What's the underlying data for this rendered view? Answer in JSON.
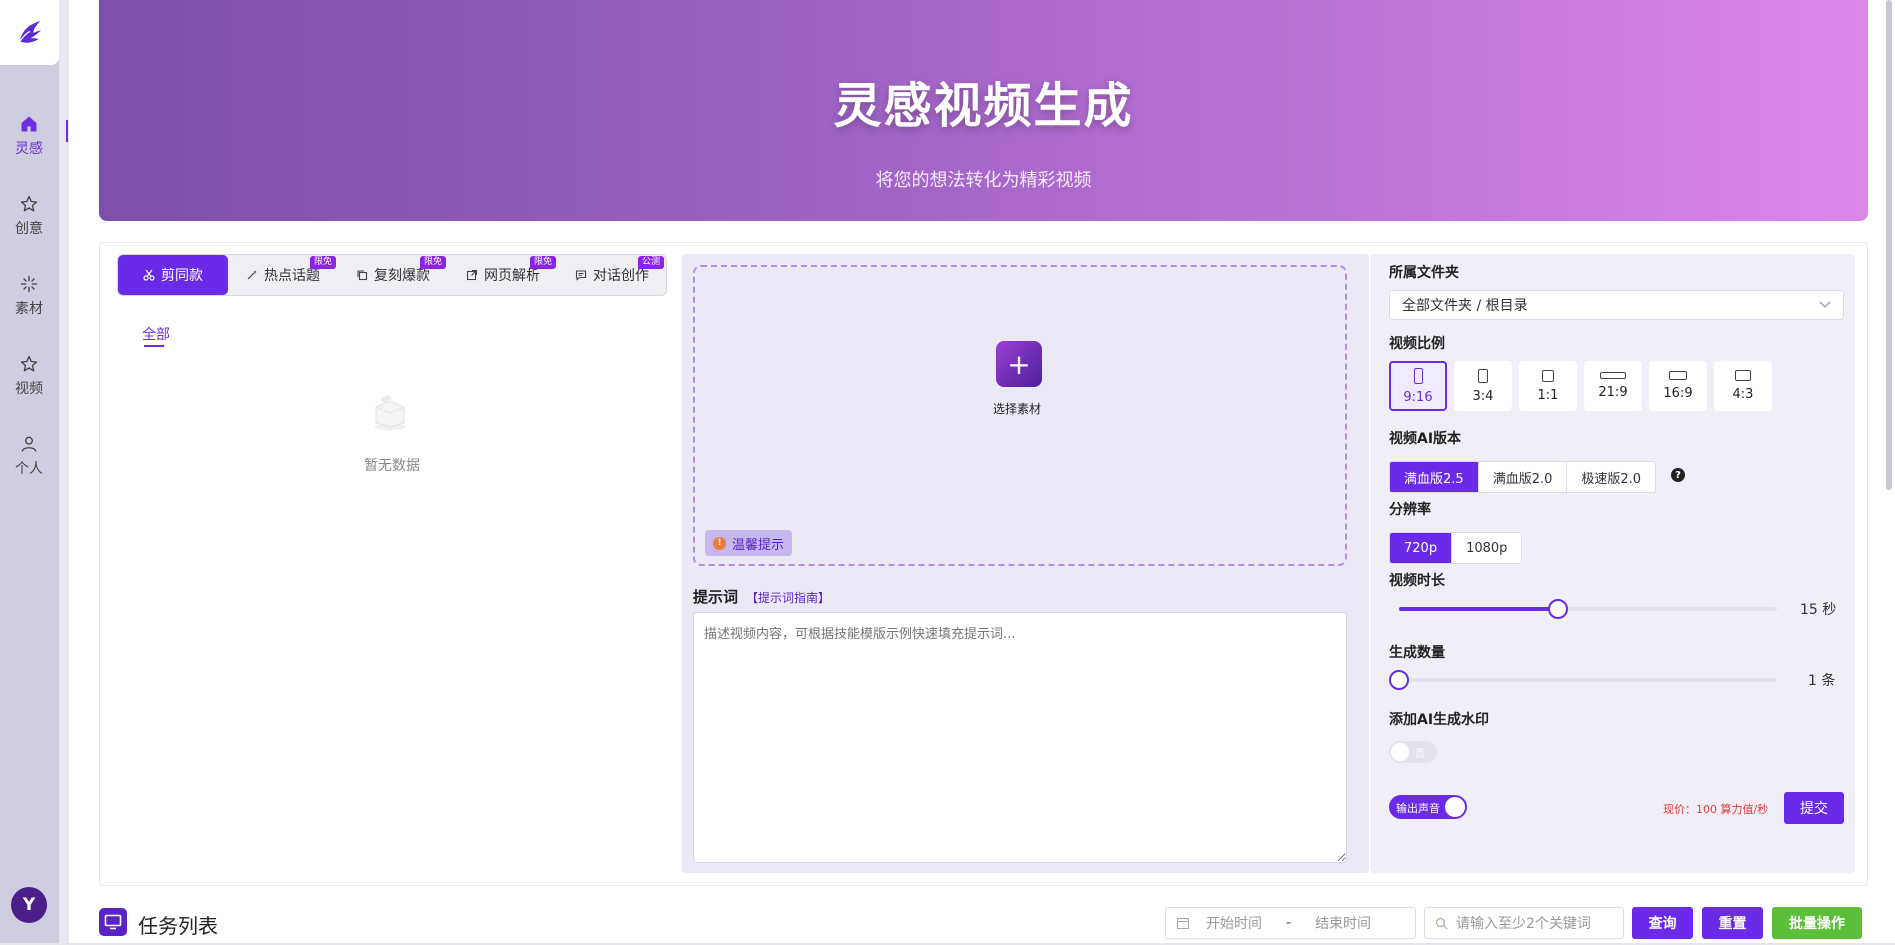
{
  "sidebar": {
    "items": [
      {
        "label": "灵感",
        "icon": "home-icon",
        "active": true
      },
      {
        "label": "创意",
        "icon": "star-icon"
      },
      {
        "label": "素材",
        "icon": "sparkle-icon"
      },
      {
        "label": "视频",
        "icon": "star-icon"
      },
      {
        "label": "个人",
        "icon": "user-icon"
      }
    ],
    "avatar": "Y"
  },
  "banner": {
    "title": "灵感视频生成",
    "subtitle": "将您的想法转化为精彩视频"
  },
  "tabs": [
    {
      "label": "剪同款",
      "icon": "scissors-icon",
      "active": true,
      "badge": ""
    },
    {
      "label": "热点话题",
      "icon": "wand-icon",
      "badge": "限免"
    },
    {
      "label": "复刻爆款",
      "icon": "copy-icon",
      "badge": "限免"
    },
    {
      "label": "网页解析",
      "icon": "external-link-icon",
      "badge": "限免"
    },
    {
      "label": "对话创作",
      "icon": "chat-icon",
      "badge": "公测"
    }
  ],
  "left": {
    "subtab": "全部",
    "empty_text": "暂无数据"
  },
  "upload": {
    "button_label": "选择素材",
    "tip_label": "温馨提示"
  },
  "prompt": {
    "label": "提示词",
    "guide": "【提示词指南】",
    "placeholder": "描述视频内容，可根据技能模版示例快速填充提示词..."
  },
  "settings": {
    "folder_label": "所属文件夹",
    "folder_value": "全部文件夹 / 根目录",
    "ratio_label": "视频比例",
    "ratios": [
      "9:16",
      "3:4",
      "1:1",
      "21:9",
      "16:9",
      "4:3"
    ],
    "ratio_selected": "9:16",
    "version_label": "视频AI版本",
    "versions": [
      "满血版2.5",
      "满血版2.0",
      "极速版2.0"
    ],
    "version_selected": "满血版2.5",
    "resolution_label": "分辨率",
    "resolutions": [
      "720p",
      "1080p"
    ],
    "resolution_selected": "720p",
    "duration_label": "视频时长",
    "duration_value": "15 秒",
    "duration_fraction": 0.42,
    "count_label": "生成数量",
    "count_value": "1 条",
    "count_fraction": 0,
    "watermark_label": "添加AI生成水印",
    "watermark_toggle": "否",
    "audio_toggle": "输出声音",
    "price": "现价：100 算力值/秒",
    "submit": "提交"
  },
  "tasks": {
    "title": "任务列表",
    "start_placeholder": "开始时间",
    "separator": "-",
    "end_placeholder": "结束时间",
    "keyword_placeholder": "请输入至少2个关键词",
    "query": "查询",
    "reset": "重置",
    "batch": "批量操作"
  },
  "colors": {
    "accent": "#6a2be8",
    "batch_button": "#5cbf3a",
    "price": "#e83a3a"
  }
}
